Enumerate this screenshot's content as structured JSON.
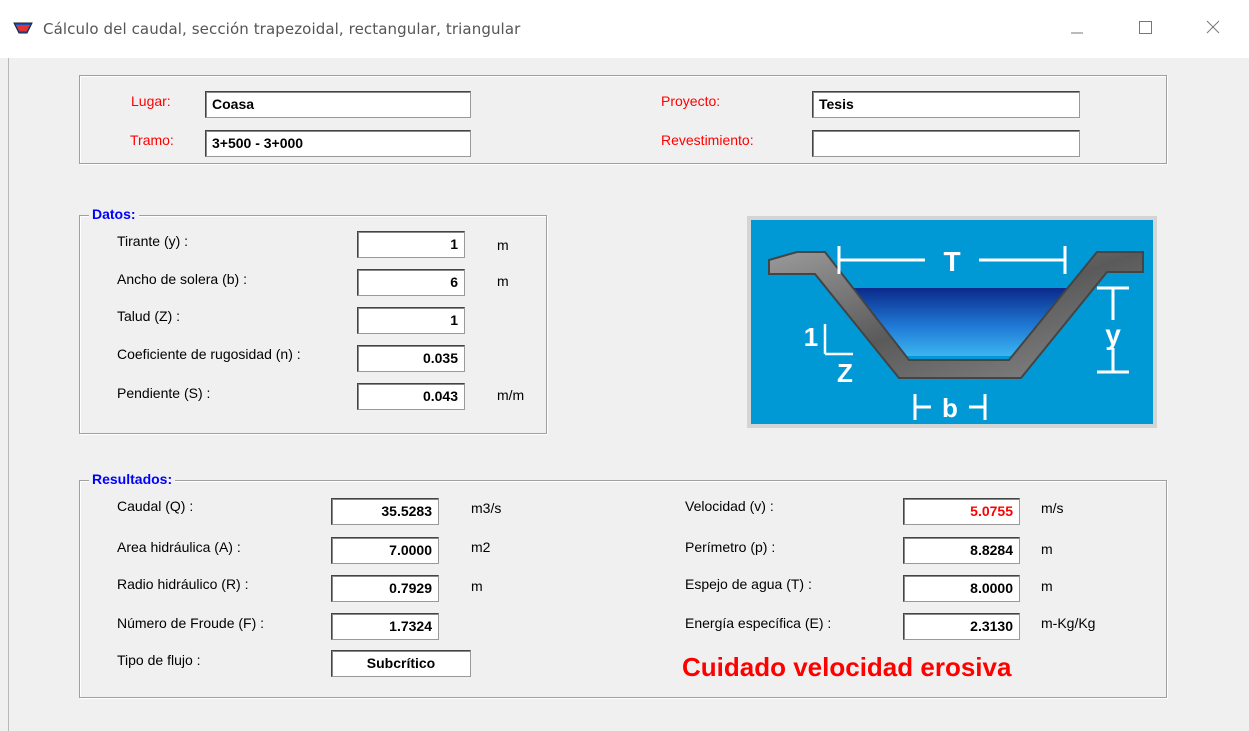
{
  "window": {
    "title": "Cálculo del caudal, sección trapezoidal, rectangular, triangular",
    "minimize_glyph": "—",
    "maximize_glyph": "☐",
    "close_glyph": "✕"
  },
  "header": {
    "lugar_label": "Lugar:",
    "lugar_value": "Coasa",
    "tramo_label": "Tramo:",
    "tramo_value": "3+500 - 3+000",
    "proyecto_label": "Proyecto:",
    "proyecto_value": "Tesis",
    "revestimiento_label": "Revestimiento:",
    "revestimiento_value": ""
  },
  "datos": {
    "title": "Datos:",
    "rows": [
      {
        "label": "Tirante (y) :",
        "value": "1",
        "unit": "m"
      },
      {
        "label": "Ancho de solera (b) :",
        "value": "6",
        "unit": "m"
      },
      {
        "label": "Talud  (Z) :",
        "value": "1",
        "unit": ""
      },
      {
        "label": "Coeficiente de rugosidad (n) :",
        "value": "0.035",
        "unit": ""
      },
      {
        "label": "Pendiente (S) :",
        "value": "0.043",
        "unit": "m/m"
      }
    ]
  },
  "diagram": {
    "labels": {
      "T": "T",
      "y": "y",
      "one": "1",
      "Z": "Z",
      "b": "b"
    },
    "colors": {
      "background": "#0099d6",
      "frame": "#d4d4d4",
      "water_top": "#0a2a8a",
      "water_bottom": "#2ea6e6",
      "lining": "#6a6a6a"
    }
  },
  "resultados": {
    "title": "Resultados:",
    "left": [
      {
        "label": "Caudal (Q) :",
        "value": "35.5283",
        "unit": "m3/s"
      },
      {
        "label": "Area hidráulica (A) :",
        "value": "7.0000",
        "unit": "m2"
      },
      {
        "label": "Radio hidráulico (R) :",
        "value": "0.7929",
        "unit": "m"
      },
      {
        "label": "Número de Froude (F) :",
        "value": "1.7324",
        "unit": ""
      },
      {
        "label": "Tipo de flujo :",
        "value": "Subcrítico",
        "unit": ""
      }
    ],
    "right": [
      {
        "label": "Velocidad (v) :",
        "value": "5.0755",
        "unit": "m/s"
      },
      {
        "label": "Perímetro (p) :",
        "value": "8.8284",
        "unit": "m"
      },
      {
        "label": "Espejo de agua (T) :",
        "value": "8.0000",
        "unit": "m"
      },
      {
        "label": "Energía específica (E) :",
        "value": "2.3130",
        "unit": "m-Kg/Kg"
      }
    ],
    "warning": "Cuidado velocidad erosiva"
  },
  "colors": {
    "label_red": "#ff0000",
    "group_title_blue": "#0000ff",
    "warning_red": "#ff0000"
  }
}
